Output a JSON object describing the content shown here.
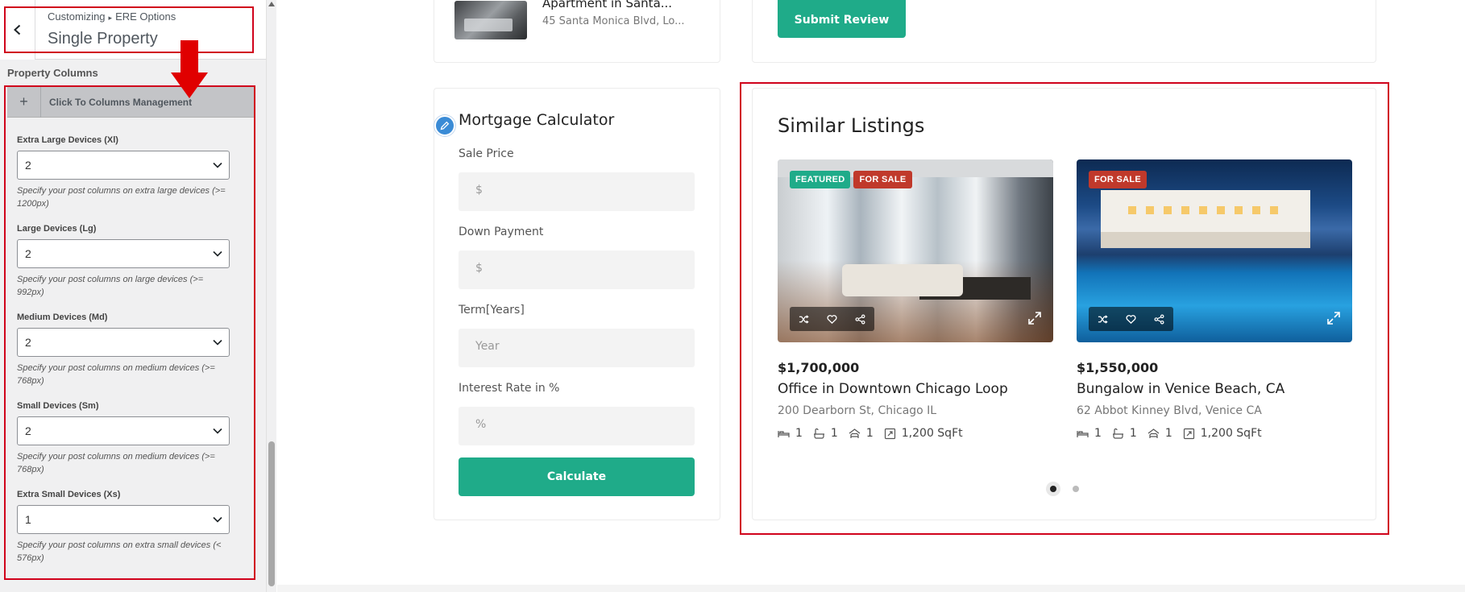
{
  "customizer": {
    "breadcrumb_parent": "Customizing",
    "breadcrumb_child": "ERE Options",
    "title": "Single Property",
    "section_label": "Property Columns",
    "toggle_label": "Click To Columns Management",
    "fields": [
      {
        "label": "Extra Large Devices (Xl)",
        "value": "2",
        "desc": "Specify your post columns on extra large devices (>= 1200px)"
      },
      {
        "label": "Large Devices (Lg)",
        "value": "2",
        "desc": "Specify your post columns on large devices (>= 992px)"
      },
      {
        "label": "Medium Devices (Md)",
        "value": "2",
        "desc": "Specify your post columns on medium devices (>= 768px)"
      },
      {
        "label": "Small Devices (Sm)",
        "value": "2",
        "desc": "Specify your post columns on medium devices (>= 768px)"
      },
      {
        "label": "Extra Small Devices (Xs)",
        "value": "1",
        "desc": "Specify your post columns on extra small devices (< 576px)"
      }
    ]
  },
  "top_property": {
    "title": "Apartment in Santa...",
    "address": "45 Santa Monica Blvd, Lo..."
  },
  "submit_review_label": "Submit Review",
  "mortgage": {
    "title": "Mortgage Calculator",
    "sale_price_label": "Sale Price",
    "sale_price_placeholder": "$",
    "down_payment_label": "Down Payment",
    "down_payment_placeholder": "$",
    "term_label": "Term[Years]",
    "term_placeholder": "Year",
    "interest_label": "Interest Rate in %",
    "interest_placeholder": "%",
    "calculate_label": "Calculate"
  },
  "similar": {
    "title": "Similar Listings",
    "listings": [
      {
        "badges": [
          "FEATURED",
          "FOR SALE"
        ],
        "price": "$1,700,000",
        "title": "Office in Downtown Chicago Loop",
        "address": "200 Dearborn St, Chicago IL",
        "beds": "1",
        "baths": "1",
        "garages": "1",
        "area": "1,200 SqFt"
      },
      {
        "badges": [
          "FOR SALE"
        ],
        "price": "$1,550,000",
        "title": "Bungalow in Venice Beach, CA",
        "address": "62 Abbot Kinney Blvd, Venice CA",
        "beds": "1",
        "baths": "1",
        "garages": "1",
        "area": "1,200 SqFt"
      }
    ],
    "pagination": {
      "pages": 2,
      "active": 1
    }
  },
  "colors": {
    "accent": "#1fab89",
    "sale_badge": "#c0392b",
    "annotation": "#d0021b",
    "edit_button": "#3a8bd6"
  },
  "icons": {
    "back": "chevron-left-icon",
    "toggle": "plus-icon",
    "select": "chevron-down-icon",
    "compare": "shuffle-icon",
    "favorite": "heart-icon",
    "share": "share-icon",
    "expand": "expand-icon",
    "beds": "bed-icon",
    "baths": "bath-icon",
    "garages": "car-icon",
    "area": "area-icon",
    "edit": "pencil-icon",
    "annotation": "red-down-arrow-icon"
  }
}
